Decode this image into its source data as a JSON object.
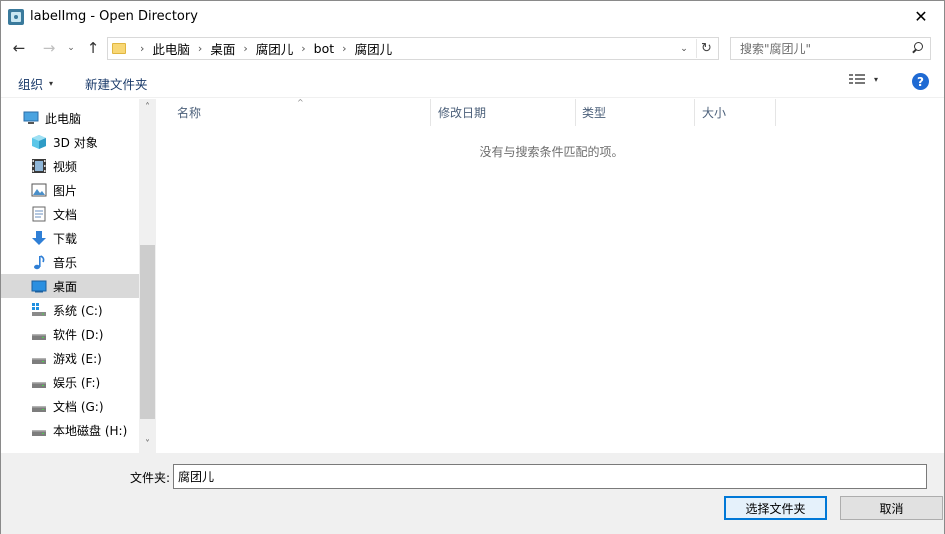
{
  "window": {
    "title": "labelImg - Open Directory",
    "close_glyph": "✕"
  },
  "nav": {
    "back_glyph": "←",
    "forward_glyph": "→",
    "recent_glyph": "⌄",
    "up_glyph": "↑",
    "breadcrumbs": [
      "此电脑",
      "桌面",
      "腐团儿",
      "bot",
      "腐团儿"
    ],
    "separator": "›",
    "dropdown_glyph": "⌄",
    "refresh_glyph": "↻"
  },
  "search": {
    "placeholder": "搜索\"腐团儿\""
  },
  "toolbar": {
    "organize_label": "组织",
    "new_folder_label": "新建文件夹",
    "caret": "▾",
    "help_label": "?"
  },
  "tree": {
    "items": [
      {
        "label": "此电脑",
        "icon": "computer-icon"
      },
      {
        "label": "3D 对象",
        "icon": "3d-objects-icon"
      },
      {
        "label": "视频",
        "icon": "video-icon"
      },
      {
        "label": "图片",
        "icon": "picture-icon"
      },
      {
        "label": "文档",
        "icon": "document-icon"
      },
      {
        "label": "下载",
        "icon": "download-icon"
      },
      {
        "label": "音乐",
        "icon": "music-icon"
      },
      {
        "label": "桌面",
        "icon": "desktop-icon",
        "selected": true
      },
      {
        "label": "系统 (C:)",
        "icon": "system-drive-icon"
      },
      {
        "label": "软件 (D:)",
        "icon": "drive-icon"
      },
      {
        "label": "游戏 (E:)",
        "icon": "drive-icon"
      },
      {
        "label": "娱乐 (F:)",
        "icon": "drive-icon"
      },
      {
        "label": "文档 (G:)",
        "icon": "drive-icon"
      },
      {
        "label": "本地磁盘 (H:)",
        "icon": "drive-icon"
      }
    ],
    "scroll_up_glyph": "˄",
    "scroll_down_glyph": "˅"
  },
  "filelist": {
    "columns": [
      "名称",
      "修改日期",
      "类型",
      "大小"
    ],
    "sort_glyph": "^",
    "empty_message": "没有与搜索条件匹配的项。"
  },
  "footer": {
    "folder_label": "文件夹:",
    "folder_value": "腐团儿",
    "select_button": "选择文件夹",
    "cancel_button": "取消"
  },
  "colors": {
    "accent": "#0078d7",
    "selection": "#d9d9d9",
    "help_blue": "#1f6ad3"
  }
}
